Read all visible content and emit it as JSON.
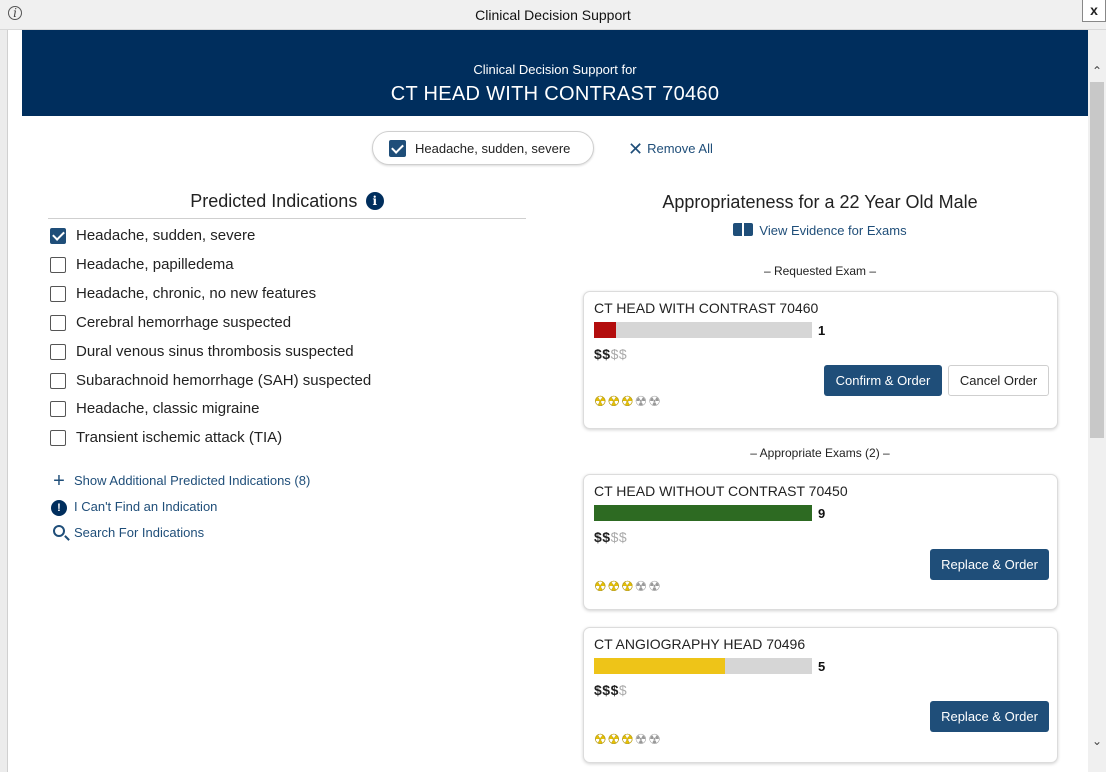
{
  "window": {
    "title": "Clinical Decision Support",
    "close_label": "x",
    "info_label": "i"
  },
  "banner": {
    "subtitle": "Clinical Decision Support for",
    "exam": "CT HEAD WITH CONTRAST 70460"
  },
  "selection": {
    "chip_label": "Headache, sudden, severe",
    "remove_all_label": "Remove All"
  },
  "left": {
    "heading": "Predicted Indications",
    "indications": [
      {
        "label": "Headache, sudden, severe",
        "checked": true
      },
      {
        "label": "Headache, papilledema",
        "checked": false
      },
      {
        "label": "Headache, chronic, no new features",
        "checked": false
      },
      {
        "label": "Cerebral hemorrhage suspected",
        "checked": false
      },
      {
        "label": "Dural venous sinus thrombosis suspected",
        "checked": false
      },
      {
        "label": "Subarachnoid hemorrhage (SAH) suspected",
        "checked": false
      },
      {
        "label": "Headache, classic migraine",
        "checked": false
      },
      {
        "label": "Transient ischemic attack (TIA)",
        "checked": false
      }
    ],
    "links": {
      "show_additional": "Show Additional Predicted Indications (8)",
      "cant_find": "I Can't Find an Indication",
      "search": "Search For Indications"
    }
  },
  "right": {
    "heading": "Appropriateness for a 22 Year Old Male",
    "evidence_link": "View Evidence for Exams",
    "requested_label": "– Requested Exam –",
    "appropriate_label": "– Appropriate Exams (2) –",
    "exams": [
      {
        "name": "CT HEAD WITH CONTRAST 70460",
        "score": "1",
        "score_fraction": 0.1,
        "bar_color": "#b30d0d",
        "cost_on": "$$",
        "cost_off": "$$",
        "radiation_on": "☢☢☢",
        "radiation_off": "☢☢",
        "primary_button": "Confirm & Order",
        "secondary_button": "Cancel Order"
      },
      {
        "name": "CT HEAD WITHOUT CONTRAST 70450",
        "score": "9",
        "score_fraction": 1.0,
        "bar_color": "#2d6a22",
        "cost_on": "$$",
        "cost_off": "$$",
        "radiation_on": "☢☢☢",
        "radiation_off": "☢☢",
        "primary_button": "Replace & Order"
      },
      {
        "name": "CT ANGIOGRAPHY HEAD 70496",
        "score": "5",
        "score_fraction": 0.6,
        "bar_color": "#eec418",
        "cost_on": "$$$",
        "cost_off": "$",
        "radiation_on": "☢☢☢",
        "radiation_off": "☢☢",
        "primary_button": "Replace & Order"
      }
    ]
  },
  "colors": {
    "navy": "#002e5d",
    "link": "#1f4e79",
    "radiation": "#e8c100"
  }
}
